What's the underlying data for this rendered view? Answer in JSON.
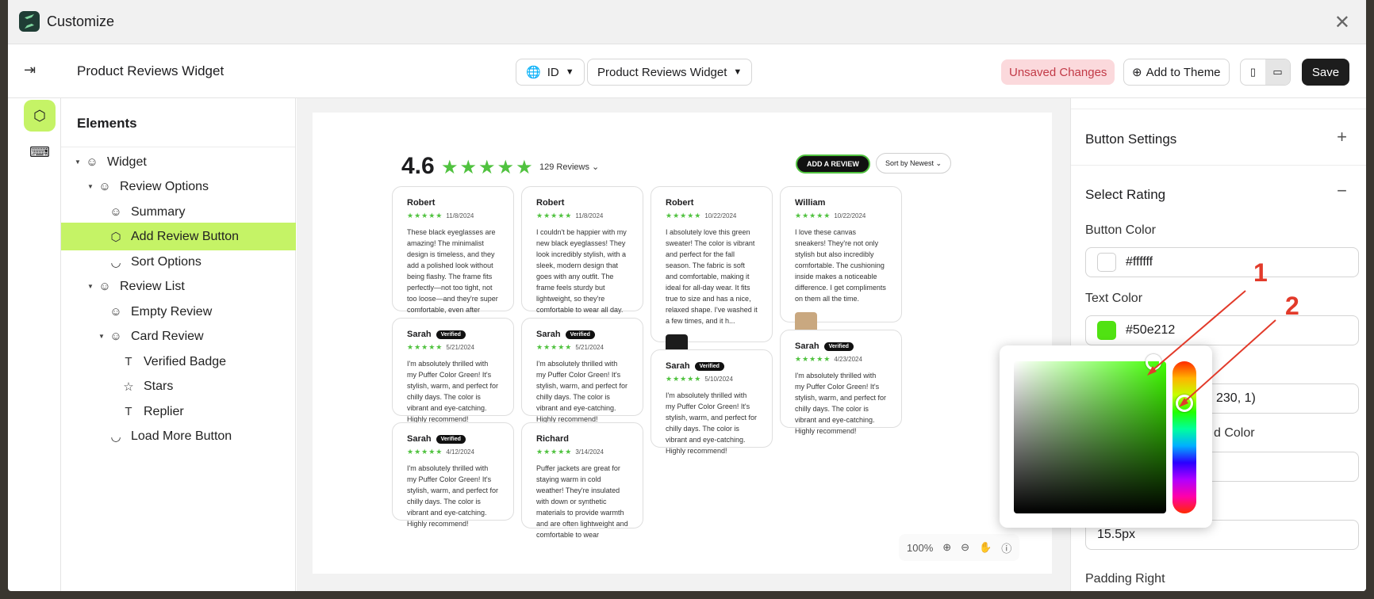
{
  "window": {
    "title": "Customize"
  },
  "topbar": {
    "page_name": "Product Reviews Widget",
    "language": "ID",
    "widget_select": "Product Reviews Widget",
    "unsaved": "Unsaved Changes",
    "add_to_theme": "Add to Theme",
    "save": "Save"
  },
  "tree": {
    "heading": "Elements",
    "nodes": [
      {
        "label": "Widget"
      },
      {
        "label": "Review Options"
      },
      {
        "label": "Summary"
      },
      {
        "label": "Add Review Button"
      },
      {
        "label": "Sort Options"
      },
      {
        "label": "Review List"
      },
      {
        "label": "Empty Review"
      },
      {
        "label": "Card Review"
      },
      {
        "label": "Verified Badge"
      },
      {
        "label": "Stars"
      },
      {
        "label": "Replier"
      },
      {
        "label": "Load More Button"
      }
    ]
  },
  "preview": {
    "rating": "4.6",
    "stars": "★★★★★",
    "count": "129 Reviews",
    "add_review": "ADD A REVIEW",
    "sort": "Sort by Newest",
    "verified": "Verified",
    "cards": [
      {
        "name": "Robert",
        "date": "11/8/2024",
        "body": "These black eyeglasses are amazing! The minimalist design is timeless, and they add a polished look without being flashy. The frame fits perfectly—not too tight, not too loose—and they're super comfortable, even after wearing them for hours. The qual..."
      },
      {
        "name": "Robert",
        "date": "11/8/2024",
        "body": "I couldn't be happier with my new black eyeglasses! They look incredibly stylish, with a sleek, modern design that goes with any outfit. The frame feels sturdy but lightweight, so they're comfortable to wear all day. The lenses offer clear vision wit..."
      },
      {
        "name": "Robert",
        "date": "10/22/2024",
        "body": "I absolutely love this green sweater! The color is vibrant and perfect for the fall season. The fabric is soft and comfortable, making it ideal for all-day wear. It fits true to size and has a nice, relaxed shape. I've washed it a few times, and it h..."
      },
      {
        "name": "William",
        "date": "10/22/2024",
        "body": "I love these canvas sneakers! They're not only stylish but also incredibly comfortable. The cushioning inside makes a noticeable difference. I get compliments on them all the time."
      },
      {
        "name": "Sarah",
        "date": "5/21/2024",
        "body": "I'm absolutely thrilled with my Puffer Color Green! It's stylish, warm, and perfect for chilly days. The color is vibrant and eye-catching. Highly recommend!"
      },
      {
        "name": "Sarah",
        "date": "5/21/2024",
        "body": "I'm absolutely thrilled with my Puffer Color Green! It's stylish, warm, and perfect for chilly days. The color is vibrant and eye-catching. Highly recommend!"
      },
      {
        "name": "Sarah",
        "date": "5/10/2024",
        "body": "I'm absolutely thrilled with my Puffer Color Green! It's stylish, warm, and perfect for chilly days. The color is vibrant and eye-catching. Highly recommend!"
      },
      {
        "name": "Sarah",
        "date": "4/23/2024",
        "body": "I'm absolutely thrilled with my Puffer Color Green! It's stylish, warm, and perfect for chilly days. The color is vibrant and eye-catching. Highly recommend!"
      },
      {
        "name": "Sarah",
        "date": "4/12/2024",
        "body": "I'm absolutely thrilled with my Puffer Color Green! It's stylish, warm, and perfect for chilly days. The color is vibrant and eye-catching. Highly recommend!"
      },
      {
        "name": "Richard",
        "date": "3/14/2024",
        "body": "Puffer jackets are great for staying warm in cold weather! They're insulated with down or synthetic materials to provide warmth and are often lightweight and comfortable to wear"
      }
    ],
    "zoom": "100%"
  },
  "panel": {
    "button_settings": "Button Settings",
    "select_rating": "Select Rating",
    "button_color_label": "Button Color",
    "button_color": "#ffffff",
    "text_color_label": "Text Color",
    "text_color": "#50e212",
    "partial_value": "230, 1)",
    "partial_label": "d Color",
    "size_value": "15.5px",
    "padding_right": "Padding Right"
  },
  "annotations": {
    "one": "1",
    "two": "2"
  },
  "colors": {
    "accent": "#c5f366",
    "star": "#50c23f",
    "text_swatch": "#50e212",
    "annotation": "#e23a2a"
  }
}
